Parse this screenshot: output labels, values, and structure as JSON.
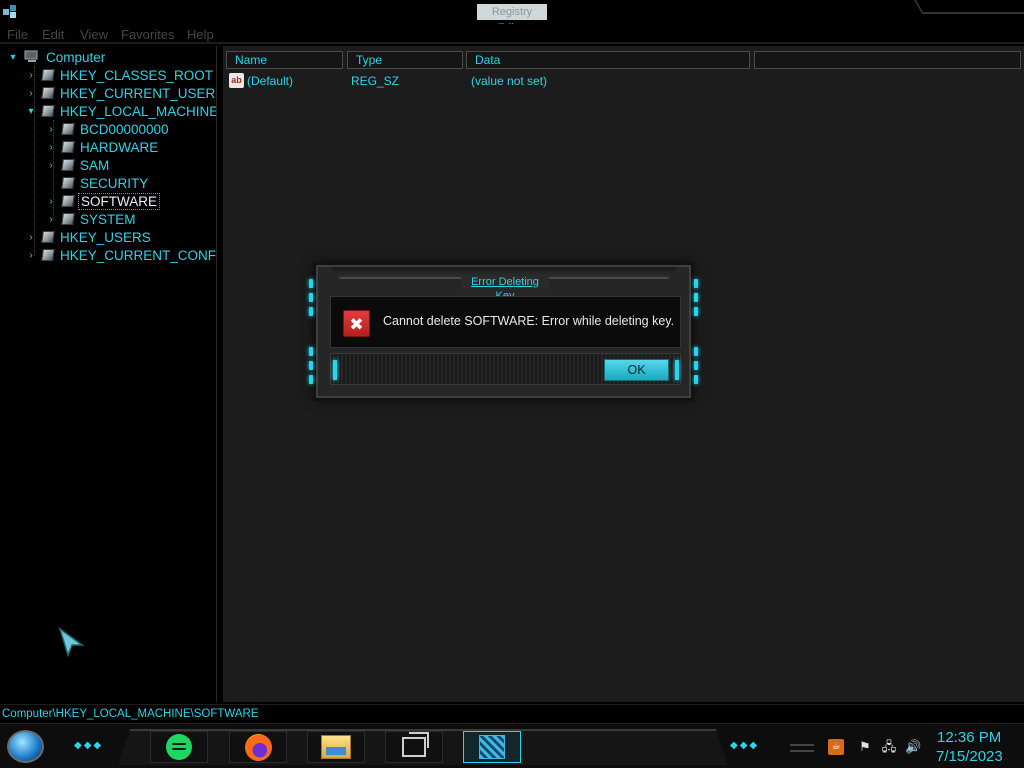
{
  "window": {
    "title": "Registry Editor"
  },
  "menu": {
    "items": [
      {
        "label": "File"
      },
      {
        "label": "Edit"
      },
      {
        "label": "View"
      },
      {
        "label": "Favorites"
      },
      {
        "label": "Help"
      }
    ]
  },
  "tree": {
    "root": "Computer",
    "hives": [
      "HKEY_CLASSES_ROOT",
      "HKEY_CURRENT_USER",
      "HKEY_LOCAL_MACHINE",
      "HKEY_USERS",
      "HKEY_CURRENT_CONFI"
    ],
    "hklm_children": [
      "BCD00000000",
      "HARDWARE",
      "SAM",
      "SECURITY",
      "SOFTWARE",
      "SYSTEM"
    ],
    "selected": "SOFTWARE"
  },
  "list": {
    "columns": [
      "Name",
      "Type",
      "Data"
    ],
    "rows": [
      {
        "name": "(Default)",
        "type": "REG_SZ",
        "data": "(value not set)",
        "icon": "ab-string-icon"
      }
    ]
  },
  "status": {
    "path": "Computer\\HKEY_LOCAL_MACHINE\\SOFTWARE"
  },
  "dialog": {
    "title": "Error Deleting Key",
    "message": "Cannot delete SOFTWARE:  Error while deleting key.",
    "ok_label": "OK",
    "icon": "error-icon"
  },
  "taskbar": {
    "apps": [
      "spotify-icon",
      "firefox-icon",
      "file-explorer-icon",
      "task-view-icon",
      "registry-editor-icon"
    ],
    "active_app": "registry-editor-icon",
    "clock_time": "12:36 PM",
    "clock_date": "7/15/2023"
  },
  "colors": {
    "accent": "#2ad4e6",
    "background": "#000000",
    "list_background": "#1c1c1c",
    "error_red": "#d32f2f"
  }
}
